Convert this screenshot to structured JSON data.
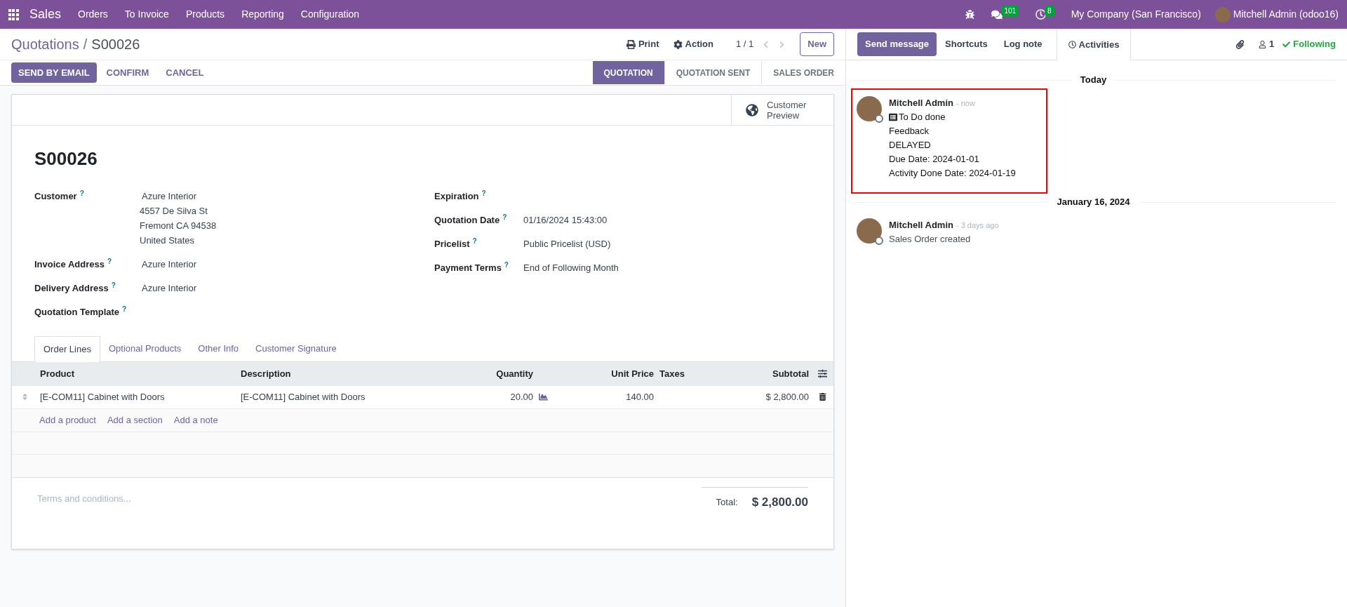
{
  "navbar": {
    "app": "Sales",
    "menu": [
      "Orders",
      "To Invoice",
      "Products",
      "Reporting",
      "Configuration"
    ],
    "messages_count": "101",
    "activities_count": "8",
    "company": "My Company (San Francisco)",
    "user": "Mitchell Admin (odoo16)"
  },
  "breadcrumb": {
    "parent": "Quotations",
    "separator": "/",
    "current": "S00026"
  },
  "control_panel": {
    "print": "Print",
    "action": "Action",
    "pager": "1 / 1",
    "new": "New"
  },
  "actions": [
    {
      "label": "SEND BY EMAIL",
      "primary": true
    },
    {
      "label": "CONFIRM",
      "primary": false
    },
    {
      "label": "CANCEL",
      "primary": false
    }
  ],
  "status_steps": [
    {
      "label": "QUOTATION",
      "selected": true
    },
    {
      "label": "QUOTATION SENT",
      "selected": false
    },
    {
      "label": "SALES ORDER",
      "selected": false
    }
  ],
  "customer_preview": "Customer Preview",
  "title": "S00026",
  "left_fields": [
    {
      "label": "Customer",
      "help": "?",
      "value": "Azure Interior",
      "address": [
        "4557 De Silva St",
        "Fremont CA 94538",
        "United States"
      ]
    },
    {
      "label": "Invoice Address",
      "help": "?",
      "value": "Azure Interior"
    },
    {
      "label": "Delivery Address",
      "help": "?",
      "value": "Azure Interior"
    },
    {
      "label": "Quotation Template",
      "help": "?"
    }
  ],
  "right_fields": [
    {
      "label": "Expiration",
      "help": "?"
    },
    {
      "label": "Quotation Date",
      "help": "?",
      "value": "01/16/2024 15:43:00"
    },
    {
      "label": "Pricelist",
      "help": "?",
      "value": "Public Pricelist (USD)"
    },
    {
      "label": "Payment Terms",
      "help": "?",
      "value": "End of Following Month"
    }
  ],
  "tabs": [
    {
      "label": "Order Lines",
      "selected": true
    },
    {
      "label": "Optional Products",
      "selected": false
    },
    {
      "label": "Other Info",
      "selected": false
    },
    {
      "label": "Customer Signature",
      "selected": false
    }
  ],
  "table": {
    "columns": [
      "Product",
      "Description",
      "Quantity",
      "Unit Price",
      "Taxes",
      "Subtotal"
    ],
    "rows": [
      {
        "product": "[E-COM11] Cabinet with Doors",
        "description": "[E-COM11] Cabinet with Doors",
        "quantity": "20.00",
        "unit_price": "140.00",
        "subtotal": "$ 2,800.00"
      }
    ],
    "add_links": [
      "Add a product",
      "Add a section",
      "Add a note"
    ]
  },
  "terms_placeholder": "Terms and conditions...",
  "total": {
    "label": "Total:",
    "value": "$ 2,800.00"
  },
  "chatter": {
    "buttons": [
      {
        "label": "Send message",
        "selected": true
      },
      {
        "label": "Shortcuts",
        "selected": false
      },
      {
        "label": "Log note",
        "selected": false
      }
    ],
    "activities": "Activities",
    "followers": "1",
    "following": "Following",
    "groups": [
      {
        "date": "Today",
        "messages": [
          {
            "author": "Mitchell Admin",
            "time": "- now",
            "highlighted": true,
            "lines": [
              "To Do done",
              "Feedback",
              "DELAYED",
              "Due Date: 2024-01-01",
              "Activity Done Date: 2024-01-19"
            ],
            "first_line_icon": true
          }
        ]
      },
      {
        "date": "January 16, 2024",
        "messages": [
          {
            "author": "Mitchell Admin",
            "time": "- 3 days ago",
            "highlighted": false,
            "lines": [
              "Sales Order created"
            ],
            "first_line_icon": false
          }
        ]
      }
    ]
  }
}
